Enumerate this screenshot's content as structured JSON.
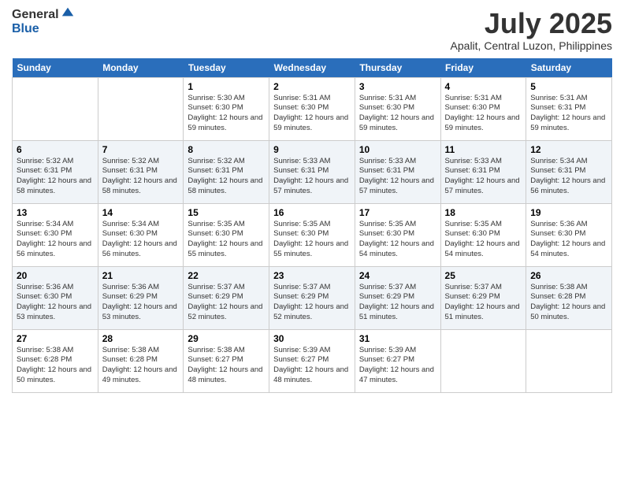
{
  "logo": {
    "general": "General",
    "blue": "Blue"
  },
  "title": "July 2025",
  "location": "Apalit, Central Luzon, Philippines",
  "days_header": [
    "Sunday",
    "Monday",
    "Tuesday",
    "Wednesday",
    "Thursday",
    "Friday",
    "Saturday"
  ],
  "weeks": [
    [
      {
        "day": "",
        "sunrise": "",
        "sunset": "",
        "daylight": ""
      },
      {
        "day": "",
        "sunrise": "",
        "sunset": "",
        "daylight": ""
      },
      {
        "day": "1",
        "sunrise": "Sunrise: 5:30 AM",
        "sunset": "Sunset: 6:30 PM",
        "daylight": "Daylight: 12 hours and 59 minutes."
      },
      {
        "day": "2",
        "sunrise": "Sunrise: 5:31 AM",
        "sunset": "Sunset: 6:30 PM",
        "daylight": "Daylight: 12 hours and 59 minutes."
      },
      {
        "day": "3",
        "sunrise": "Sunrise: 5:31 AM",
        "sunset": "Sunset: 6:30 PM",
        "daylight": "Daylight: 12 hours and 59 minutes."
      },
      {
        "day": "4",
        "sunrise": "Sunrise: 5:31 AM",
        "sunset": "Sunset: 6:30 PM",
        "daylight": "Daylight: 12 hours and 59 minutes."
      },
      {
        "day": "5",
        "sunrise": "Sunrise: 5:31 AM",
        "sunset": "Sunset: 6:31 PM",
        "daylight": "Daylight: 12 hours and 59 minutes."
      }
    ],
    [
      {
        "day": "6",
        "sunrise": "Sunrise: 5:32 AM",
        "sunset": "Sunset: 6:31 PM",
        "daylight": "Daylight: 12 hours and 58 minutes."
      },
      {
        "day": "7",
        "sunrise": "Sunrise: 5:32 AM",
        "sunset": "Sunset: 6:31 PM",
        "daylight": "Daylight: 12 hours and 58 minutes."
      },
      {
        "day": "8",
        "sunrise": "Sunrise: 5:32 AM",
        "sunset": "Sunset: 6:31 PM",
        "daylight": "Daylight: 12 hours and 58 minutes."
      },
      {
        "day": "9",
        "sunrise": "Sunrise: 5:33 AM",
        "sunset": "Sunset: 6:31 PM",
        "daylight": "Daylight: 12 hours and 57 minutes."
      },
      {
        "day": "10",
        "sunrise": "Sunrise: 5:33 AM",
        "sunset": "Sunset: 6:31 PM",
        "daylight": "Daylight: 12 hours and 57 minutes."
      },
      {
        "day": "11",
        "sunrise": "Sunrise: 5:33 AM",
        "sunset": "Sunset: 6:31 PM",
        "daylight": "Daylight: 12 hours and 57 minutes."
      },
      {
        "day": "12",
        "sunrise": "Sunrise: 5:34 AM",
        "sunset": "Sunset: 6:31 PM",
        "daylight": "Daylight: 12 hours and 56 minutes."
      }
    ],
    [
      {
        "day": "13",
        "sunrise": "Sunrise: 5:34 AM",
        "sunset": "Sunset: 6:30 PM",
        "daylight": "Daylight: 12 hours and 56 minutes."
      },
      {
        "day": "14",
        "sunrise": "Sunrise: 5:34 AM",
        "sunset": "Sunset: 6:30 PM",
        "daylight": "Daylight: 12 hours and 56 minutes."
      },
      {
        "day": "15",
        "sunrise": "Sunrise: 5:35 AM",
        "sunset": "Sunset: 6:30 PM",
        "daylight": "Daylight: 12 hours and 55 minutes."
      },
      {
        "day": "16",
        "sunrise": "Sunrise: 5:35 AM",
        "sunset": "Sunset: 6:30 PM",
        "daylight": "Daylight: 12 hours and 55 minutes."
      },
      {
        "day": "17",
        "sunrise": "Sunrise: 5:35 AM",
        "sunset": "Sunset: 6:30 PM",
        "daylight": "Daylight: 12 hours and 54 minutes."
      },
      {
        "day": "18",
        "sunrise": "Sunrise: 5:35 AM",
        "sunset": "Sunset: 6:30 PM",
        "daylight": "Daylight: 12 hours and 54 minutes."
      },
      {
        "day": "19",
        "sunrise": "Sunrise: 5:36 AM",
        "sunset": "Sunset: 6:30 PM",
        "daylight": "Daylight: 12 hours and 54 minutes."
      }
    ],
    [
      {
        "day": "20",
        "sunrise": "Sunrise: 5:36 AM",
        "sunset": "Sunset: 6:30 PM",
        "daylight": "Daylight: 12 hours and 53 minutes."
      },
      {
        "day": "21",
        "sunrise": "Sunrise: 5:36 AM",
        "sunset": "Sunset: 6:29 PM",
        "daylight": "Daylight: 12 hours and 53 minutes."
      },
      {
        "day": "22",
        "sunrise": "Sunrise: 5:37 AM",
        "sunset": "Sunset: 6:29 PM",
        "daylight": "Daylight: 12 hours and 52 minutes."
      },
      {
        "day": "23",
        "sunrise": "Sunrise: 5:37 AM",
        "sunset": "Sunset: 6:29 PM",
        "daylight": "Daylight: 12 hours and 52 minutes."
      },
      {
        "day": "24",
        "sunrise": "Sunrise: 5:37 AM",
        "sunset": "Sunset: 6:29 PM",
        "daylight": "Daylight: 12 hours and 51 minutes."
      },
      {
        "day": "25",
        "sunrise": "Sunrise: 5:37 AM",
        "sunset": "Sunset: 6:29 PM",
        "daylight": "Daylight: 12 hours and 51 minutes."
      },
      {
        "day": "26",
        "sunrise": "Sunrise: 5:38 AM",
        "sunset": "Sunset: 6:28 PM",
        "daylight": "Daylight: 12 hours and 50 minutes."
      }
    ],
    [
      {
        "day": "27",
        "sunrise": "Sunrise: 5:38 AM",
        "sunset": "Sunset: 6:28 PM",
        "daylight": "Daylight: 12 hours and 50 minutes."
      },
      {
        "day": "28",
        "sunrise": "Sunrise: 5:38 AM",
        "sunset": "Sunset: 6:28 PM",
        "daylight": "Daylight: 12 hours and 49 minutes."
      },
      {
        "day": "29",
        "sunrise": "Sunrise: 5:38 AM",
        "sunset": "Sunset: 6:27 PM",
        "daylight": "Daylight: 12 hours and 48 minutes."
      },
      {
        "day": "30",
        "sunrise": "Sunrise: 5:39 AM",
        "sunset": "Sunset: 6:27 PM",
        "daylight": "Daylight: 12 hours and 48 minutes."
      },
      {
        "day": "31",
        "sunrise": "Sunrise: 5:39 AM",
        "sunset": "Sunset: 6:27 PM",
        "daylight": "Daylight: 12 hours and 47 minutes."
      },
      {
        "day": "",
        "sunrise": "",
        "sunset": "",
        "daylight": ""
      },
      {
        "day": "",
        "sunrise": "",
        "sunset": "",
        "daylight": ""
      }
    ]
  ]
}
